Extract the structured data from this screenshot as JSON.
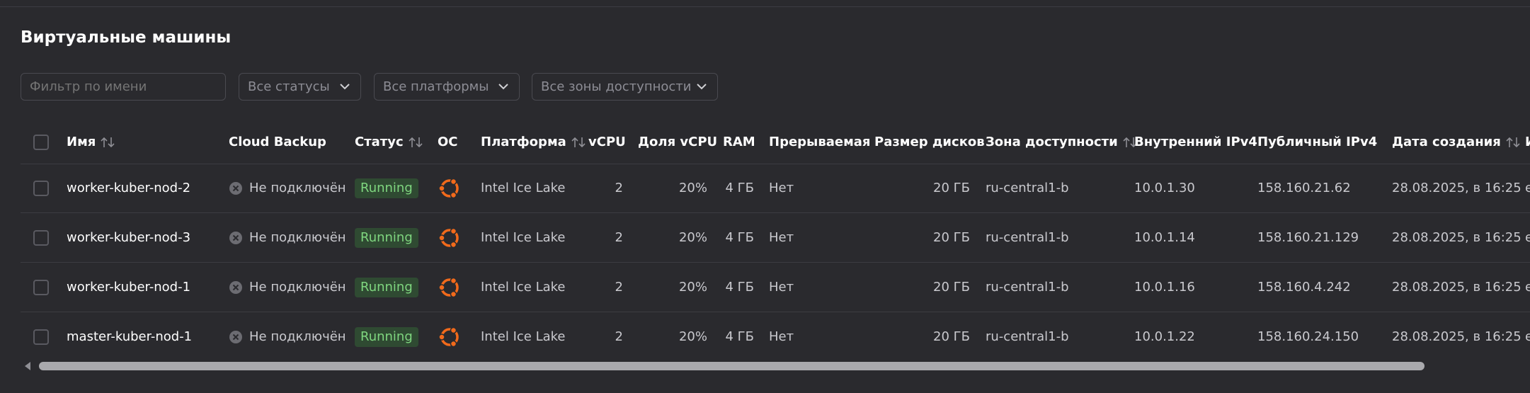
{
  "page": {
    "title": "Виртуальные машины"
  },
  "filters": {
    "name_placeholder": "Фильтр по имени",
    "status": "Все статусы",
    "platform": "Все платформы",
    "zone": "Все зоны доступности"
  },
  "table": {
    "columns": {
      "name": "Имя",
      "backup": "Cloud Backup",
      "status": "Статус",
      "os": "ОС",
      "platform": "Платформа",
      "vcpu": "vCPU",
      "vcpu_share": "Доля vCPU",
      "ram": "RAM",
      "preemptible": "Прерываемая",
      "disk_size": "Размер дисков",
      "zone": "Зона доступности",
      "internal_ip": "Внутренний IPv4",
      "public_ip": "Публичный IPv4",
      "created": "Дата создания",
      "extra": "И"
    },
    "rows": [
      {
        "name": "worker-kuber-nod-2",
        "backup": "Не подключён",
        "status": "Running",
        "os_icon": "ubuntu-icon",
        "platform": "Intel Ice Lake",
        "vcpu": "2",
        "vcpu_share": "20%",
        "ram": "4 ГБ",
        "preemptible": "Нет",
        "disk_size": "20 ГБ",
        "zone": "ru-central1-b",
        "internal_ip": "10.0.1.30",
        "public_ip": "158.160.21.62",
        "created": "28.08.2025, в 16:25",
        "extra": "e"
      },
      {
        "name": "worker-kuber-nod-3",
        "backup": "Не подключён",
        "status": "Running",
        "os_icon": "ubuntu-icon",
        "platform": "Intel Ice Lake",
        "vcpu": "2",
        "vcpu_share": "20%",
        "ram": "4 ГБ",
        "preemptible": "Нет",
        "disk_size": "20 ГБ",
        "zone": "ru-central1-b",
        "internal_ip": "10.0.1.14",
        "public_ip": "158.160.21.129",
        "created": "28.08.2025, в 16:25",
        "extra": "e"
      },
      {
        "name": "worker-kuber-nod-1",
        "backup": "Не подключён",
        "status": "Running",
        "os_icon": "ubuntu-icon",
        "platform": "Intel Ice Lake",
        "vcpu": "2",
        "vcpu_share": "20%",
        "ram": "4 ГБ",
        "preemptible": "Нет",
        "disk_size": "20 ГБ",
        "zone": "ru-central1-b",
        "internal_ip": "10.0.1.16",
        "public_ip": "158.160.4.242",
        "created": "28.08.2025, в 16:25",
        "extra": "e"
      },
      {
        "name": "master-kuber-nod-1",
        "backup": "Не подключён",
        "status": "Running",
        "os_icon": "ubuntu-icon",
        "platform": "Intel Ice Lake",
        "vcpu": "2",
        "vcpu_share": "20%",
        "ram": "4 ГБ",
        "preemptible": "Нет",
        "disk_size": "20 ГБ",
        "zone": "ru-central1-b",
        "internal_ip": "10.0.1.22",
        "public_ip": "158.160.24.150",
        "created": "28.08.2025, в 16:25",
        "extra": "e"
      }
    ]
  },
  "colors": {
    "background": "#2a2a2e",
    "running_badge_bg": "#2f4a32",
    "running_badge_text": "#7fd67f",
    "ubuntu_orange": "#f26a1b"
  }
}
